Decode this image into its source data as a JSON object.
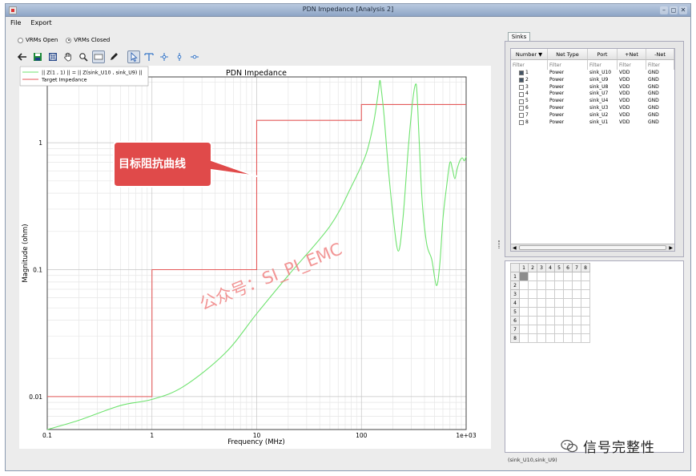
{
  "window": {
    "title": "PDN Impedance [Analysis 2]"
  },
  "menu": {
    "items": [
      "File",
      "Export"
    ]
  },
  "radios": [
    {
      "label": "VRMs Open",
      "checked": false
    },
    {
      "label": "VRMs Closed",
      "checked": true
    }
  ],
  "toolbar": {
    "buttons": [
      "back-arrow-icon",
      "save-icon",
      "zoom-fit-icon",
      "pan-hand-icon",
      "zoom-icon",
      "select-rect-icon",
      "pen-icon",
      "pointer-icon",
      "cursor-icon-1",
      "cursor-icon-2",
      "cursor-icon-3",
      "cursor-icon-4"
    ]
  },
  "chart_data": {
    "type": "line",
    "title": "PDN Impedance",
    "xlabel": "Frequency (MHz)",
    "ylabel": "Magnitude (ohm)",
    "xscale": "log",
    "yscale": "log",
    "xlim": [
      0.1,
      1000
    ],
    "ylim": [
      0.0055,
      3.3
    ],
    "x_ticks": [
      {
        "value": 0.1,
        "label": "0.1"
      },
      {
        "value": 1,
        "label": "1"
      },
      {
        "value": 10,
        "label": "10"
      },
      {
        "value": 100,
        "label": "100"
      },
      {
        "value": 1000,
        "label": "1e+03"
      }
    ],
    "y_ticks": [
      {
        "value": 0.01,
        "label": "0.01"
      },
      {
        "value": 0.1,
        "label": "0.1"
      },
      {
        "value": 1,
        "label": "1"
      }
    ],
    "grid": true,
    "legend_position": "top-left",
    "series": [
      {
        "name": "|| Z(1 , 1) || = || Z(sink_U10 , sink_U9) ||",
        "color": "#6fe36f",
        "x": [
          0.1,
          0.2,
          0.5,
          1,
          2,
          5,
          10,
          20,
          50,
          80,
          110,
          130,
          145,
          150,
          155,
          165,
          180,
          200,
          225,
          250,
          280,
          310,
          330,
          340,
          355,
          380,
          420,
          470,
          520,
          560,
          600,
          650,
          700,
          740,
          780,
          820,
          870,
          920,
          960,
          1000
        ],
        "y": [
          0.0055,
          0.0065,
          0.0085,
          0.0095,
          0.012,
          0.022,
          0.045,
          0.09,
          0.22,
          0.45,
          0.8,
          1.4,
          2.5,
          3.1,
          2.6,
          1.6,
          0.65,
          0.27,
          0.14,
          0.26,
          0.9,
          2.2,
          2.9,
          2.4,
          1.1,
          0.35,
          0.16,
          0.12,
          0.075,
          0.11,
          0.25,
          0.45,
          0.7,
          0.62,
          0.52,
          0.62,
          0.72,
          0.76,
          0.72,
          0.78
        ]
      },
      {
        "name": "Target Impedance",
        "color": "#e45a5a",
        "x": [
          0.1,
          1,
          1,
          10,
          10,
          100,
          100,
          1000
        ],
        "y": [
          0.01,
          0.01,
          0.1,
          0.1,
          1.5,
          1.5,
          2.0,
          2.0
        ]
      }
    ]
  },
  "annotation": {
    "text": "目标阻抗曲线"
  },
  "overlay_watermark": "公众号：SI_PI_EMC",
  "sinks": {
    "tab_label": "Sinks",
    "columns": [
      "Number",
      "Net Type",
      "Port",
      "+Net",
      "-Net"
    ],
    "filter_placeholder": "Filter",
    "rows": [
      {
        "number": "1",
        "net_type": "Power",
        "port": "sink_U10",
        "pos": "VDD",
        "neg": "GND",
        "checked": true
      },
      {
        "number": "2",
        "net_type": "Power",
        "port": "sink_U9",
        "pos": "VDD",
        "neg": "GND",
        "checked": true
      },
      {
        "number": "3",
        "net_type": "Power",
        "port": "sink_U8",
        "pos": "VDD",
        "neg": "GND",
        "checked": false
      },
      {
        "number": "4",
        "net_type": "Power",
        "port": "sink_U7",
        "pos": "VDD",
        "neg": "GND",
        "checked": false
      },
      {
        "number": "5",
        "net_type": "Power",
        "port": "sink_U4",
        "pos": "VDD",
        "neg": "GND",
        "checked": false
      },
      {
        "number": "6",
        "net_type": "Power",
        "port": "sink_U3",
        "pos": "VDD",
        "neg": "GND",
        "checked": false
      },
      {
        "number": "7",
        "net_type": "Power",
        "port": "sink_U2",
        "pos": "VDD",
        "neg": "GND",
        "checked": false
      },
      {
        "number": "8",
        "net_type": "Power",
        "port": "sink_U1",
        "pos": "VDD",
        "neg": "GND",
        "checked": false
      }
    ]
  },
  "matrix": {
    "labels": [
      "1",
      "2",
      "3",
      "4",
      "5",
      "6",
      "7",
      "8"
    ]
  },
  "status": {
    "text": "(sink_U10,sink_U9)"
  },
  "brand": {
    "text": "信号完整性"
  }
}
